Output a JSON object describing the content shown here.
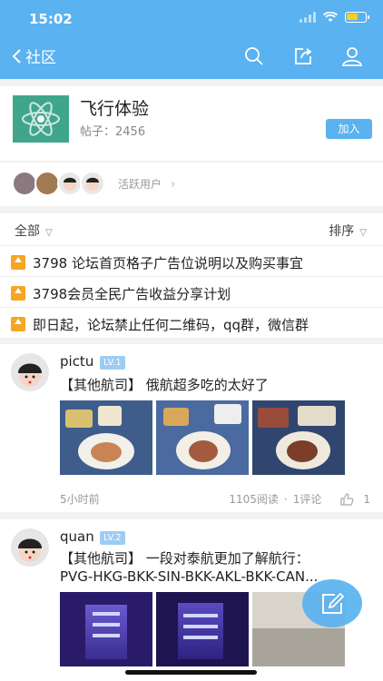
{
  "status_bar": {
    "time": "15:02"
  },
  "nav": {
    "back_label": "社区"
  },
  "forum": {
    "name": "飞行体验",
    "posts_label": "帖子：",
    "posts_count": "2456",
    "join_label": "加入"
  },
  "active_users": {
    "label": "活跃用户",
    "arrow": "›"
  },
  "filter": {
    "all_label": "全部",
    "sort_label": "排序"
  },
  "pinned": [
    {
      "text": "3798 论坛首页格子广告位说明以及购买事宜"
    },
    {
      "text": "3798会员全民广告收益分享计划"
    },
    {
      "text": "即日起，论坛禁止任何二维码，qq群，微信群"
    }
  ],
  "posts": [
    {
      "user": "pictu",
      "level": "LV.1",
      "title": "【其他航司】 俄航超多吃的太好了",
      "time": "5小时前",
      "reads": "1105阅读",
      "dot": "·",
      "comments": "1评论",
      "likes": "1"
    },
    {
      "user": "quan",
      "level": "LV.2",
      "title": "【其他航司】 一段对泰航更加了解航行：",
      "title2": "PVG-HKG-BKK-SIN-BKK-AKL-BKK-CAN..."
    }
  ],
  "colors": {
    "accent": "#5ab2f0",
    "forum_logo": "#3fa68c",
    "level_badge": "#9ecbf2",
    "pin": "#f5a623"
  },
  "icons": [
    "chevron-left-icon",
    "search-icon",
    "share-icon",
    "user-icon",
    "atom-icon",
    "pin-icon",
    "thumbs-up-icon",
    "compose-icon"
  ]
}
